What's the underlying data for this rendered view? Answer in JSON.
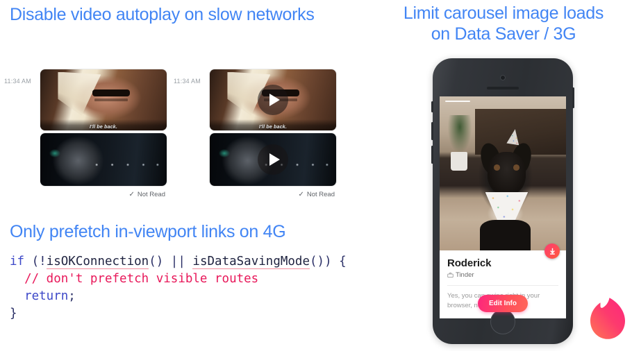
{
  "slides": {
    "left_title": "Disable video autoplay on slow networks",
    "code_title": "Only prefetch in-viewport links on 4G",
    "right_title_line1": "Limit carousel image loads",
    "right_title_line2": "on Data Saver / 3G",
    "accent_color": "#4285F4"
  },
  "chat": {
    "left": {
      "time": "11:34 AM",
      "caption": "I'll be back.",
      "status": "Not Read",
      "status_icon": "check-icon",
      "autoplay": true
    },
    "right": {
      "time": "11:34 AM",
      "caption": "I'll be back.",
      "status": "Not Read",
      "status_icon": "check-icon",
      "autoplay": false,
      "play_icon": "play-icon"
    }
  },
  "code": {
    "lines": [
      {
        "tokens": [
          {
            "text": "if",
            "type": "kw"
          },
          {
            "text": " (!",
            "type": "punc"
          },
          {
            "text": "isOKConnection",
            "type": "ident"
          },
          {
            "text": "() || ",
            "type": "punc"
          },
          {
            "text": "isDataSavingMode",
            "type": "ident"
          },
          {
            "text": "()) {",
            "type": "punc"
          }
        ]
      },
      {
        "tokens": [
          {
            "text": "  // don't prefetch visible routes",
            "type": "cmt"
          }
        ]
      },
      {
        "tokens": [
          {
            "text": "  ",
            "type": "punc"
          },
          {
            "text": "return",
            "type": "kw"
          },
          {
            "text": ";",
            "type": "punc"
          }
        ]
      },
      {
        "tokens": [
          {
            "text": "}",
            "type": "punc"
          }
        ]
      }
    ],
    "colors": {
      "keyword": "#3d48c8",
      "identifier": "#1f2340",
      "comment": "#e8185a",
      "underline": "#f28b9b"
    }
  },
  "phone": {
    "device": "iphone-se-space-gray",
    "card": {
      "name": "Roderick",
      "subtitle": "Tinder",
      "subtitle_icon": "briefcase-icon",
      "bio": "Yes, you can swipe right in your browser, no app needed.",
      "bio_line1": "Yes, you can swipe right in your",
      "bio_line2": "browser, no app needed.",
      "edit_button": "Edit Info",
      "download_badge_icon": "download-arrow-icon",
      "photo_alt": "french-bulldog-with-party-hat-and-bandana"
    },
    "brand": {
      "logo_icon": "tinder-flame-icon",
      "gradient_from": "#fd267d",
      "gradient_to": "#ff7854"
    }
  }
}
